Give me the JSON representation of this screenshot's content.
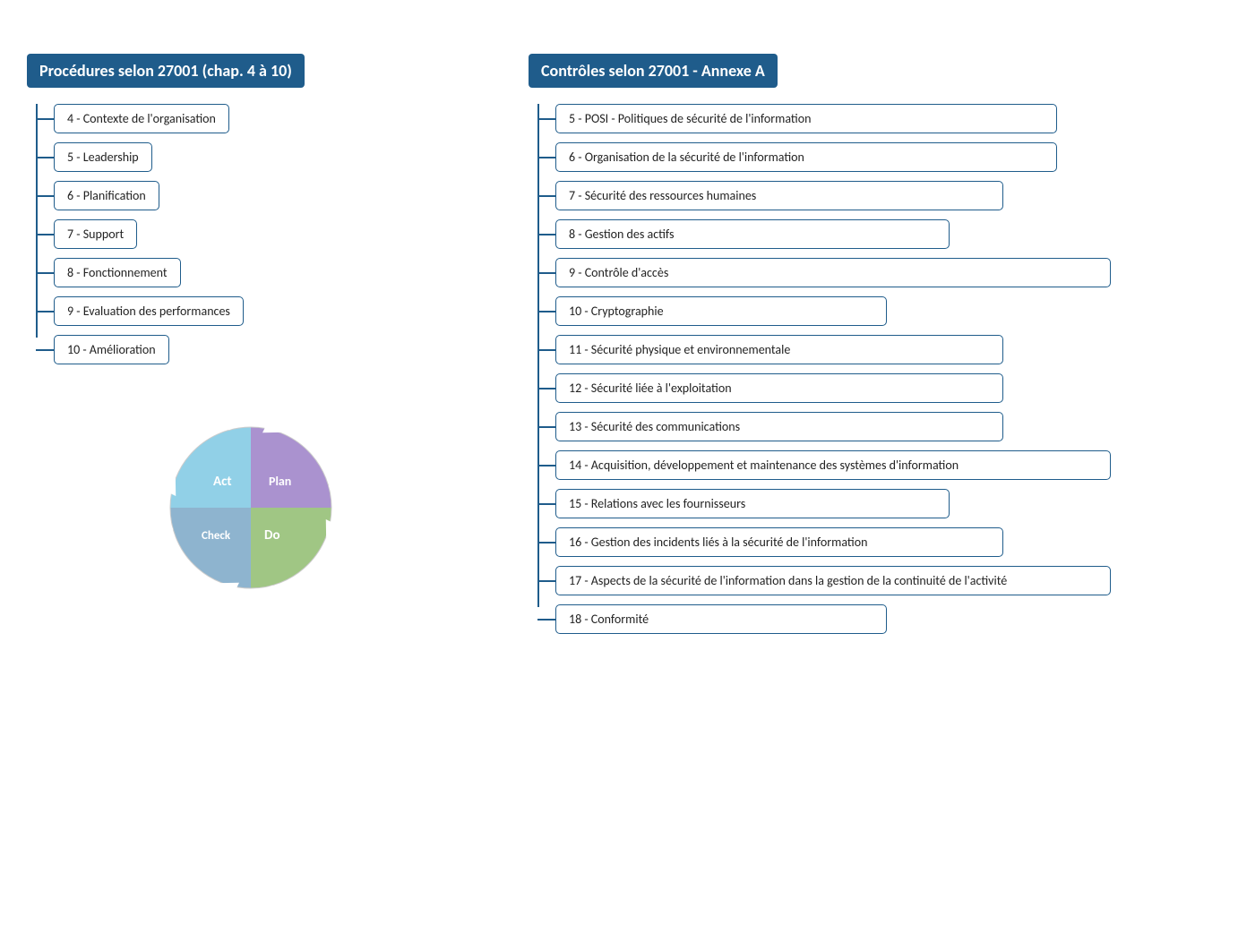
{
  "left": {
    "title": "Procédures selon 27001 (chap. 4 à 10)",
    "items": [
      "4 - Contexte de l'organisation",
      "5 - Leadership",
      "6 - Planification",
      "7 - Support",
      "8 - Fonctionnement",
      "9 - Evaluation des performances",
      "10 - Amélioration"
    ]
  },
  "right": {
    "title": "Contrôles selon 27001 - Annexe A",
    "items": [
      {
        "label": "5 - POSI - Politiques de sécurité de l'information",
        "width": "w-large"
      },
      {
        "label": "6 - Organisation de la sécurité de l'information",
        "width": "w-large"
      },
      {
        "label": "7 - Sécurité des ressources humaines",
        "width": "w-medium"
      },
      {
        "label": "8 - Gestion des actifs",
        "width": "w-small"
      },
      {
        "label": "9 - Contrôle d'accès",
        "width": "w-full"
      },
      {
        "label": "10 - Cryptographie",
        "width": "w-xsmall"
      },
      {
        "label": "11 - Sécurité physique et environnementale",
        "width": "w-medium"
      },
      {
        "label": "12 - Sécurité liée à l'exploitation",
        "width": "w-medium"
      },
      {
        "label": "13 - Sécurité des communications",
        "width": "w-medium"
      },
      {
        "label": "14 - Acquisition, développement et maintenance des systèmes d'information",
        "width": "w-full"
      },
      {
        "label": "15 - Relations avec les fournisseurs",
        "width": "w-small"
      },
      {
        "label": "16 - Gestion des incidents liés à la sécurité de l'information",
        "width": "w-medium"
      },
      {
        "label": "17 - Aspects de la sécurité de l'information dans la gestion de la continuité de l'activité",
        "width": "w-full"
      },
      {
        "label": "18 - Conformité",
        "width": "w-xsmall"
      }
    ]
  },
  "pdca": {
    "act_label": "Act",
    "plan_label": "Plan",
    "check_label": "Check",
    "do_label": "Do"
  }
}
